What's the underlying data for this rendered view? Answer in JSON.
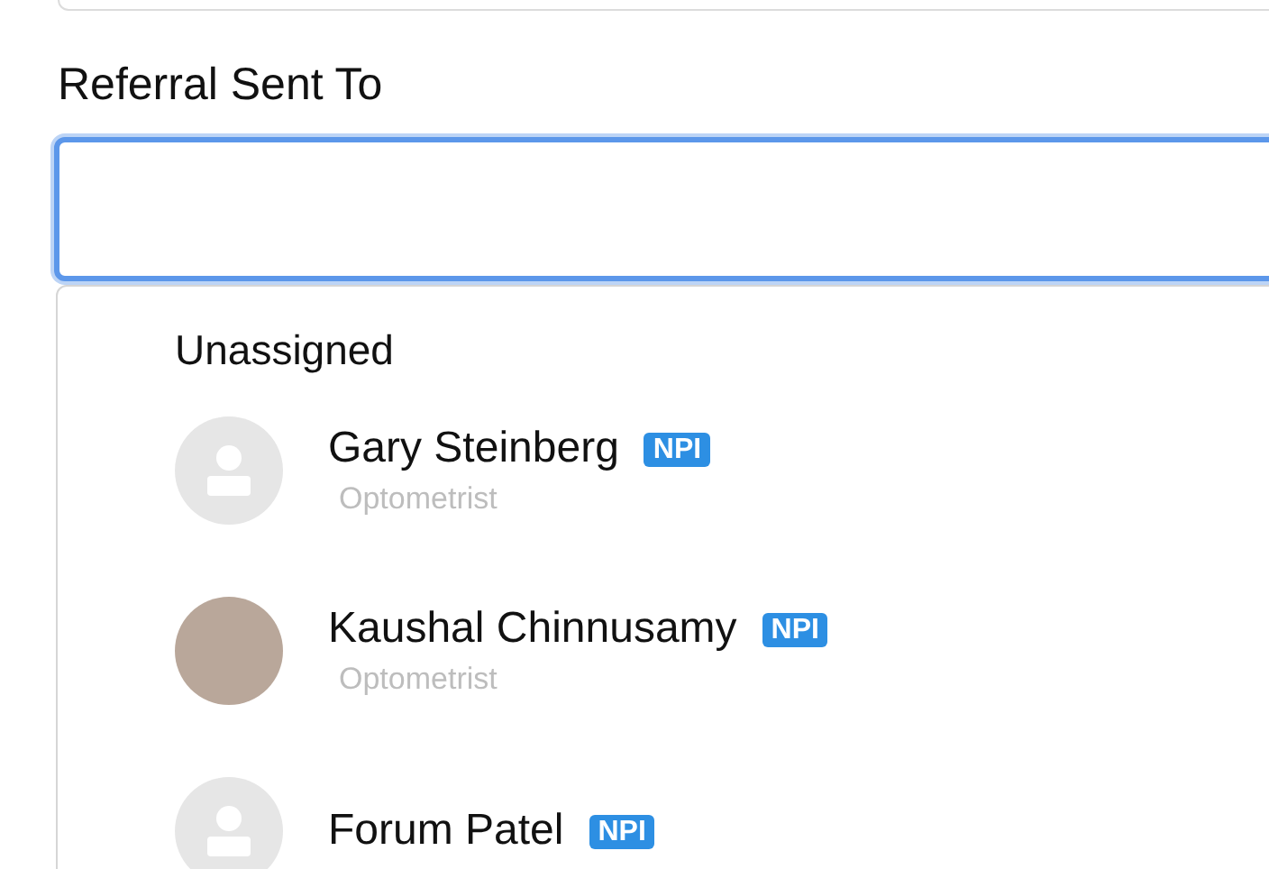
{
  "field": {
    "label": "Referral Sent To",
    "focused": true
  },
  "dropdown": {
    "unassigned_option": "Unassigned",
    "options": [
      {
        "name": "Gary Steinberg",
        "badge": "NPI",
        "role": "Optometrist",
        "avatar": {
          "kind": "placeholder"
        }
      },
      {
        "name": "Kaushal Chinnusamy",
        "badge": "NPI",
        "role": "Optometrist",
        "avatar": {
          "kind": "photo"
        }
      },
      {
        "name": "Forum Patel",
        "badge": "NPI",
        "avatar": {
          "kind": "placeholder"
        }
      }
    ]
  }
}
